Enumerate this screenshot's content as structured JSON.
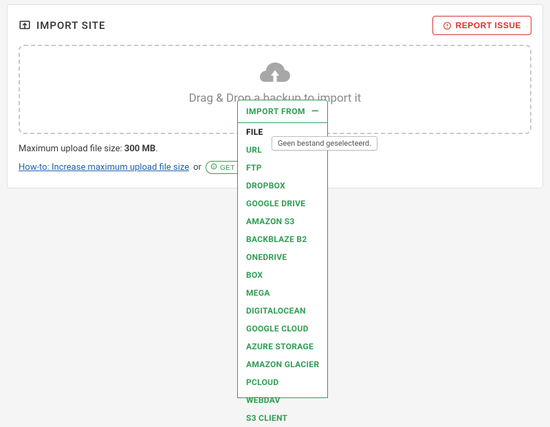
{
  "header": {
    "title": "IMPORT SITE",
    "report_label": "REPORT ISSUE"
  },
  "dropzone": {
    "text": "Drag & Drop a backup to import it"
  },
  "info": {
    "max_prefix": "Maximum upload file size: ",
    "max_size": "300 MB",
    "max_suffix": ".",
    "howto": "How-to: Increase maximum upload file size",
    "or": "or",
    "get_unlimited": "GET UNLIMITED"
  },
  "dropdown": {
    "label": "IMPORT FROM",
    "items": [
      "FILE",
      "URL",
      "FTP",
      "DROPBOX",
      "GOOGLE DRIVE",
      "AMAZON S3",
      "BACKBLAZE B2",
      "ONEDRIVE",
      "BOX",
      "MEGA",
      "DIGITALOCEAN",
      "GOOGLE CLOUD",
      "AZURE STORAGE",
      "AMAZON GLACIER",
      "PCLOUD",
      "WEBDAV",
      "S3 CLIENT"
    ]
  },
  "tooltip": {
    "text": "Geen bestand geselecteerd."
  }
}
